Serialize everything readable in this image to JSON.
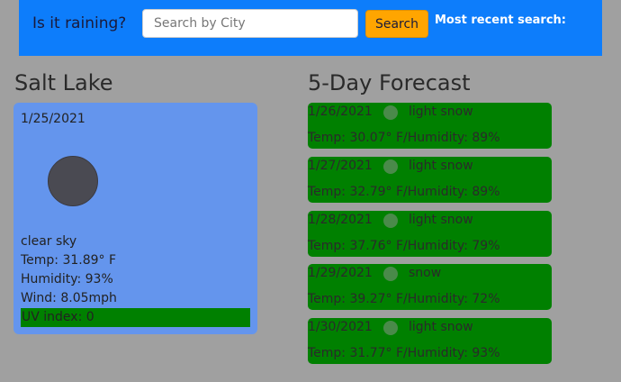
{
  "header": {
    "title": "Is it raining?",
    "search_placeholder": "Search by City",
    "search_value": "",
    "search_button": "Search",
    "recent_label": "Most recent search:"
  },
  "current": {
    "city": "Salt Lake",
    "date": "1/25/2021",
    "icon": "weather-icon",
    "description": "clear sky",
    "temp": "Temp: 31.89° F",
    "humidity": "Humidity: 93%",
    "wind": "Wind: 8.05mph",
    "uv": "UV index: 0",
    "uv_color": "#008000",
    "card_color": "#6495ed"
  },
  "forecast": {
    "title": "5-Day Forecast",
    "card_color": "#008000",
    "days": [
      {
        "date": "1/26/2021",
        "description": "light snow",
        "stats": "Temp: 30.07° F/Humidity: 89%"
      },
      {
        "date": "1/27/2021",
        "description": "light snow",
        "stats": "Temp: 32.79° F/Humidity: 89%"
      },
      {
        "date": "1/28/2021",
        "description": "light snow",
        "stats": "Temp: 37.76° F/Humidity: 79%"
      },
      {
        "date": "1/29/2021",
        "description": "snow",
        "stats": "Temp: 39.27° F/Humidity: 72%"
      },
      {
        "date": "1/30/2021",
        "description": "light snow",
        "stats": "Temp: 31.77° F/Humidity: 93%"
      }
    ]
  }
}
